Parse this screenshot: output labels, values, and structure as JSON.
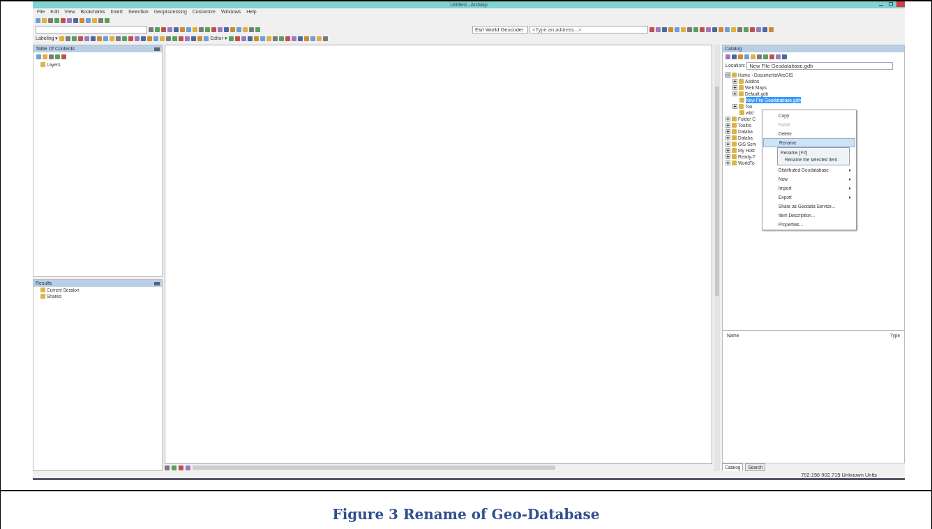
{
  "window": {
    "title": "Untitled - ArcMap"
  },
  "menu": [
    "File",
    "Edit",
    "View",
    "Bookmarks",
    "Insert",
    "Selection",
    "Geoprocessing",
    "Customize",
    "Windows",
    "Help"
  ],
  "toolbars": {
    "labeling": "Labeling ▾",
    "editor": "Editor ▾",
    "geocoder": "Esri World Geocoder",
    "address": {
      "placeholder": "<Type an address...>"
    }
  },
  "toc": {
    "title": "Table Of Contents",
    "items": [
      "Layers"
    ]
  },
  "results": {
    "title": "Results",
    "items": [
      "Current Session",
      "Shared"
    ]
  },
  "catalog": {
    "title": "Catalog",
    "location_label": "Location:",
    "location_value": "New File Geodatabase.gdb",
    "tree": [
      {
        "label": "Home - Documents\\ArcGIS",
        "expanded": true,
        "selected": false,
        "children": [
          {
            "label": "AddIns",
            "expanded": false,
            "selected": false
          },
          {
            "label": "Web Maps",
            "expanded": false,
            "selected": false
          },
          {
            "label": "Default.gdb",
            "expanded": false,
            "selected": false
          },
          {
            "label": "New File Geodatabase.gdb",
            "selected": true
          },
          {
            "label": "Too",
            "expanded": false,
            "selected": false
          },
          {
            "label": "wild",
            "selected": false
          }
        ]
      },
      {
        "label": "Folder C",
        "expanded": false,
        "selected": false
      },
      {
        "label": "Toolbo",
        "expanded": false,
        "selected": false
      },
      {
        "label": "Databa",
        "expanded": false,
        "selected": false
      },
      {
        "label": "Databa",
        "expanded": false,
        "selected": false
      },
      {
        "label": "GIS Serv",
        "expanded": false,
        "selected": false
      },
      {
        "label": "My Host",
        "expanded": false,
        "selected": false
      },
      {
        "label": "Ready-T",
        "expanded": false,
        "selected": false
      },
      {
        "label": "WorldTo",
        "expanded": false,
        "selected": false
      }
    ],
    "context_menu": [
      {
        "kind": "item",
        "label": "Copy",
        "disabled": false,
        "selected": false,
        "submenu": false
      },
      {
        "kind": "item",
        "label": "Paste",
        "disabled": true,
        "selected": false,
        "submenu": false
      },
      {
        "kind": "item",
        "label": "Delete",
        "disabled": false,
        "selected": false,
        "submenu": false
      },
      {
        "kind": "item",
        "label": "Rename",
        "disabled": false,
        "selected": true,
        "submenu": false
      },
      {
        "kind": "hidden"
      },
      {
        "kind": "hidden"
      },
      {
        "kind": "item",
        "label": "Distributed Geodatabase",
        "disabled": false,
        "selected": false,
        "submenu": true
      },
      {
        "kind": "item",
        "label": "New",
        "disabled": false,
        "selected": false,
        "submenu": true
      },
      {
        "kind": "item",
        "label": "Import",
        "disabled": false,
        "selected": false,
        "submenu": true
      },
      {
        "kind": "item",
        "label": "Export",
        "disabled": false,
        "selected": false,
        "submenu": true
      },
      {
        "kind": "item",
        "label": "Share as Geodata Service...",
        "disabled": false,
        "selected": false,
        "submenu": false
      },
      {
        "kind": "item",
        "label": "Item Description...",
        "disabled": false,
        "selected": false,
        "submenu": false
      },
      {
        "kind": "item",
        "label": "Properties...",
        "disabled": false,
        "selected": false,
        "submenu": false
      }
    ],
    "tooltip": {
      "title": "Rename (F2)",
      "text": "Rename the selected item."
    },
    "columns": [
      "Name",
      "Type"
    ],
    "tabs": [
      {
        "label": "Catalog",
        "selected": true
      },
      {
        "label": "Search",
        "selected": false
      }
    ]
  },
  "status": "792.156  902.715 Unknown Units",
  "caption": "Figure 3 Rename of Geo-Database"
}
